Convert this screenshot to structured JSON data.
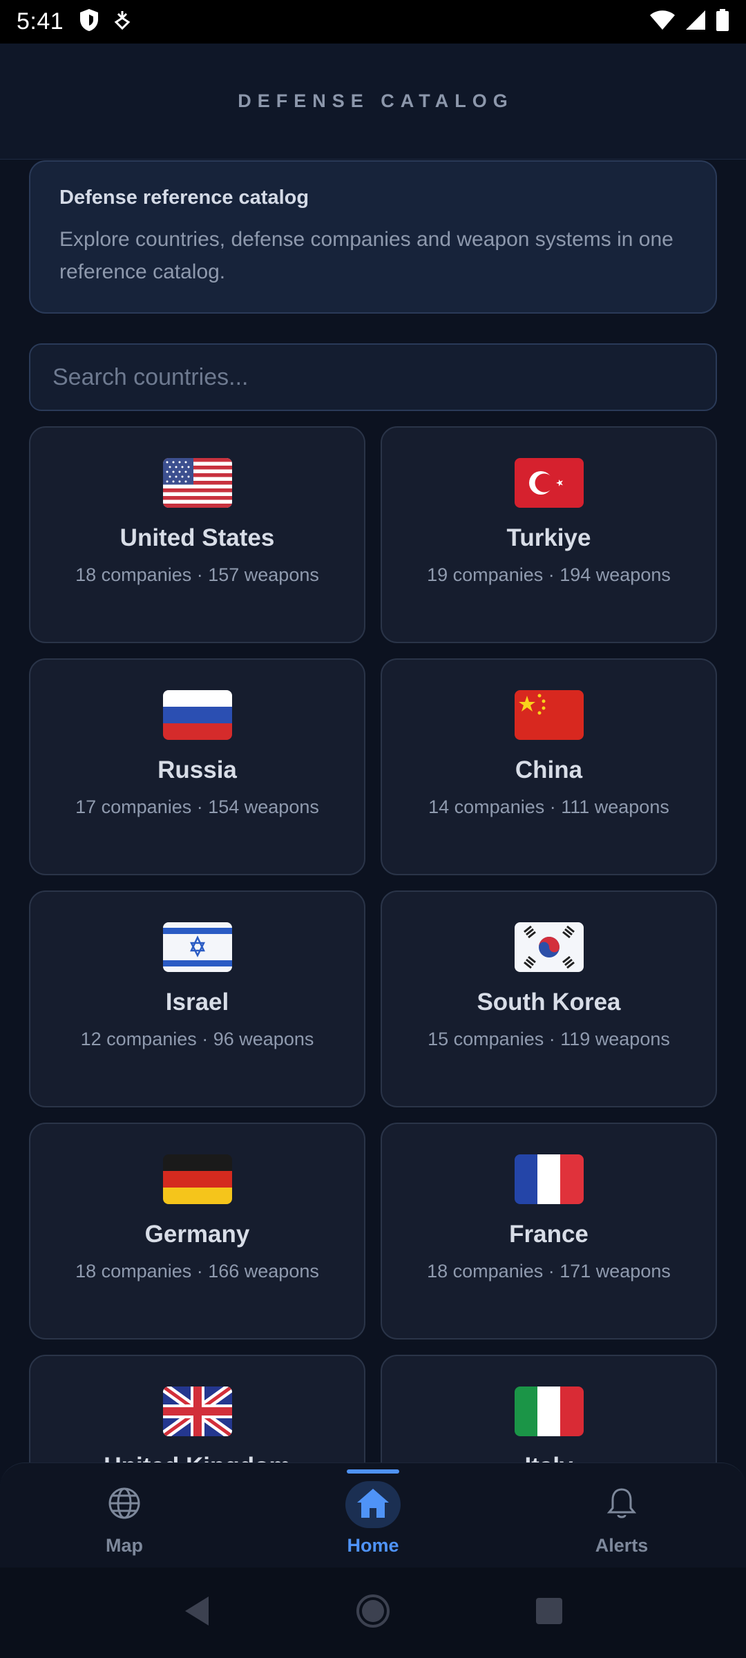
{
  "status_bar": {
    "time": "5:41",
    "icons": [
      "shield-icon",
      "download-sync-icon",
      "wifi-icon",
      "signal-icon",
      "battery-icon"
    ]
  },
  "header": {
    "title": "DEFENSE CATALOG"
  },
  "intro": {
    "title": "Defense reference catalog",
    "text": "Explore countries, defense companies and weapon systems in one reference catalog."
  },
  "search": {
    "placeholder": "Search countries...",
    "value": ""
  },
  "countries": [
    {
      "name": "United States",
      "stats": "18 companies · 157 weapons",
      "flag": "us-flag-icon"
    },
    {
      "name": "Turkiye",
      "stats": "19 companies · 194 weapons",
      "flag": "turkiye-flag-icon"
    },
    {
      "name": "Russia",
      "stats": "17 companies · 154 weapons",
      "flag": "russia-flag-icon"
    },
    {
      "name": "China",
      "stats": "14 companies · 111 weapons",
      "flag": "china-flag-icon"
    },
    {
      "name": "Israel",
      "stats": "12 companies · 96 weapons",
      "flag": "israel-flag-icon"
    },
    {
      "name": "South Korea",
      "stats": "15 companies · 119 weapons",
      "flag": "south-korea-flag-icon"
    },
    {
      "name": "Germany",
      "stats": "18 companies · 166 weapons",
      "flag": "germany-flag-icon"
    },
    {
      "name": "France",
      "stats": "18 companies · 171 weapons",
      "flag": "france-flag-icon"
    },
    {
      "name": "United Kingdom",
      "stats": "",
      "flag": "uk-flag-icon"
    },
    {
      "name": "Italy",
      "stats": "",
      "flag": "italy-flag-icon"
    }
  ],
  "bottom_nav": {
    "items": [
      {
        "label": "Map",
        "icon": "globe-icon",
        "active": false
      },
      {
        "label": "Home",
        "icon": "home-icon",
        "active": true
      },
      {
        "label": "Alerts",
        "icon": "bell-icon",
        "active": false
      }
    ]
  },
  "colors": {
    "background": "#0c1220",
    "card": "#161d2e",
    "accent": "#4f93f7",
    "muted_text": "#8f9aae"
  }
}
